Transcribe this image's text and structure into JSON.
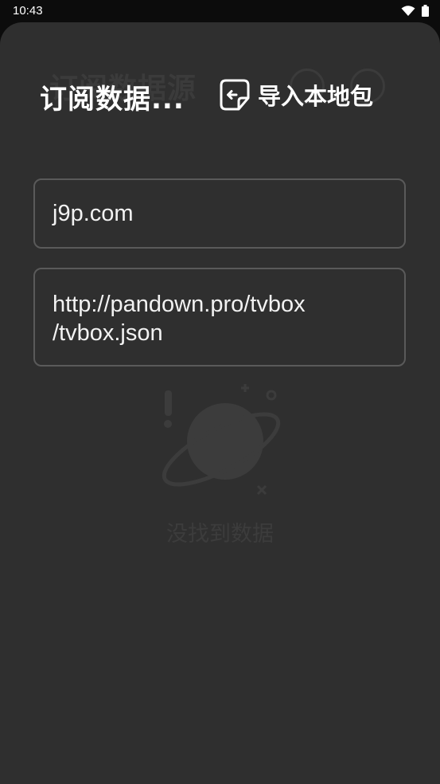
{
  "status_bar": {
    "time": "10:43"
  },
  "background": {
    "title": "订阅数据源",
    "empty_text": "没找到数据"
  },
  "header": {
    "title": "订阅数据...",
    "import_label": "导入本地包"
  },
  "sources": [
    {
      "url_line1": "j9p.com"
    },
    {
      "url_line1": "http://pandown.pro/tvbox",
      "url_line2": "/tvbox.json"
    }
  ],
  "icons": {
    "wifi": "wifi-icon",
    "battery": "battery-icon",
    "import": "import-file-icon",
    "empty": "planet-illustration"
  }
}
